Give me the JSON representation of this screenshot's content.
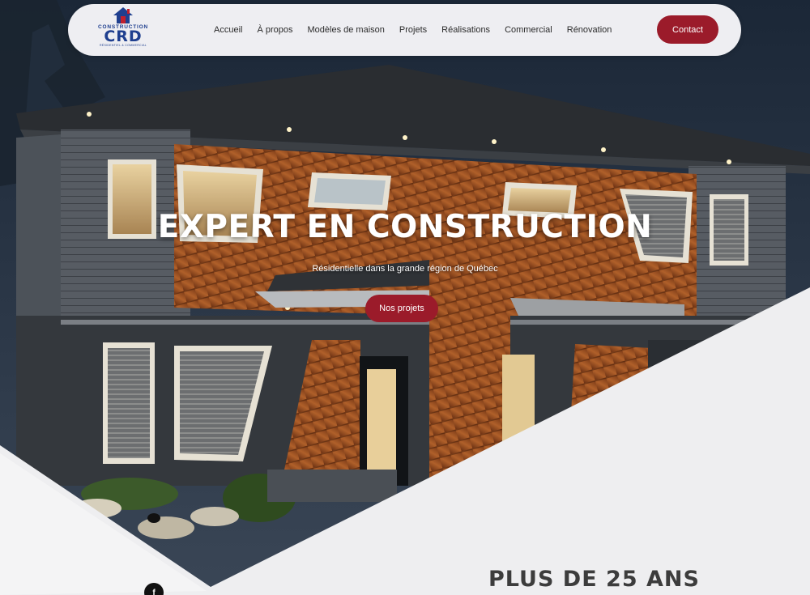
{
  "navbar": {
    "logo": {
      "word": "CONSTRUCTION",
      "mark": "CRD",
      "sub": "RÉSIDENTIEL & COMMERCIAL"
    },
    "links": [
      "Accueil",
      "À propos",
      "Modèles de maison",
      "Projets",
      "Réalisations",
      "Commercial",
      "Rénovation"
    ],
    "contact_label": "Contact"
  },
  "hero": {
    "title": "EXPERT EN CONSTRUCTION",
    "subtitle": "Résidentielle dans la grande région de Québec",
    "cta_label": "Nos projets"
  },
  "section": {
    "title": "PLUS DE 25 ANS",
    "social_icon": "facebook-icon",
    "social_glyph": "f"
  },
  "colors": {
    "accent": "#9b1b2a",
    "nav_bg": "#eeeef2",
    "brand_blue": "#1f3f8f",
    "section_bg": "#eeeef0"
  }
}
